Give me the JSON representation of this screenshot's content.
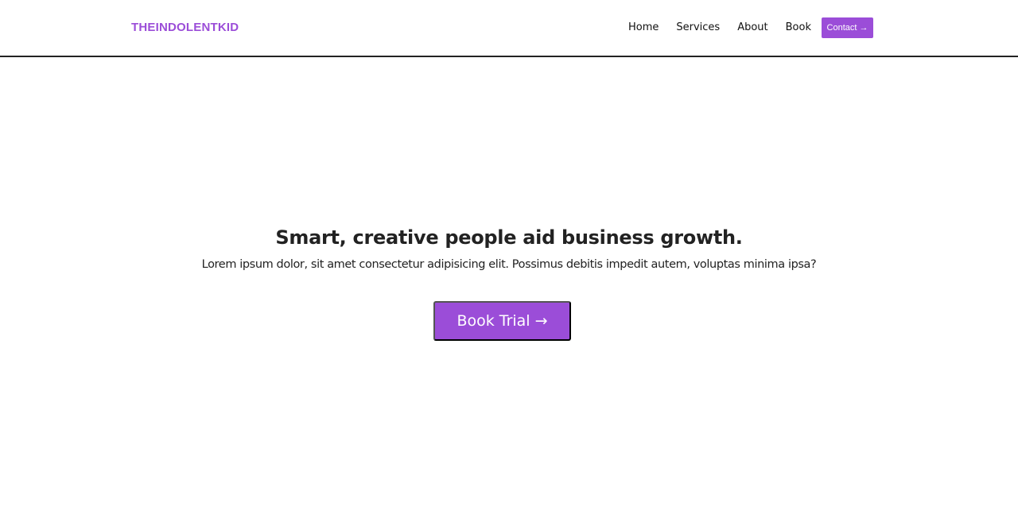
{
  "navbar": {
    "logo": "THEINDOLENTKID",
    "links": [
      "Home",
      "Services",
      "About",
      "Book"
    ],
    "contact_label": "Contact →"
  },
  "hero": {
    "title": "Smart, creative people aid business growth.",
    "subtitle": "Lorem ipsum dolor, sit amet consectetur adipisicing elit. Possimus debitis impedit autem, voluptas minima ipsa?",
    "cta_label": "Book Trial →"
  },
  "colors": {
    "accent": "#9b4dd8",
    "text": "#222222",
    "background": "#ffffff"
  }
}
